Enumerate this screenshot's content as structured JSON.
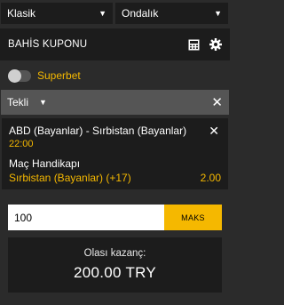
{
  "selects": {
    "bet_view": "Klasik",
    "odds_format": "Ondalık"
  },
  "header": {
    "title": "BAHİS KUPONU"
  },
  "superbet": {
    "label": "Superbet",
    "enabled": false
  },
  "bet_type": {
    "label": "Tekli"
  },
  "bet": {
    "match": "ABD (Bayanlar) - Sırbistan (Bayanlar)",
    "time": "22:00",
    "market": "Maç Handikapı",
    "selection": "Sırbistan (Bayanlar) (+17)",
    "odds": "2.00"
  },
  "stake": {
    "value": "100",
    "max_label": "MAKS"
  },
  "winnings": {
    "label": "Olası kazanç:",
    "amount": "200.00 TRY"
  },
  "colors": {
    "accent": "#f5b800",
    "panel": "#1c1c1c",
    "background": "#2b2b2b",
    "type_row": "#555555"
  },
  "icons": {
    "calculator": "calculator-icon",
    "settings": "gear-icon",
    "close": "close-icon",
    "dropdown": "caret-down-icon"
  }
}
